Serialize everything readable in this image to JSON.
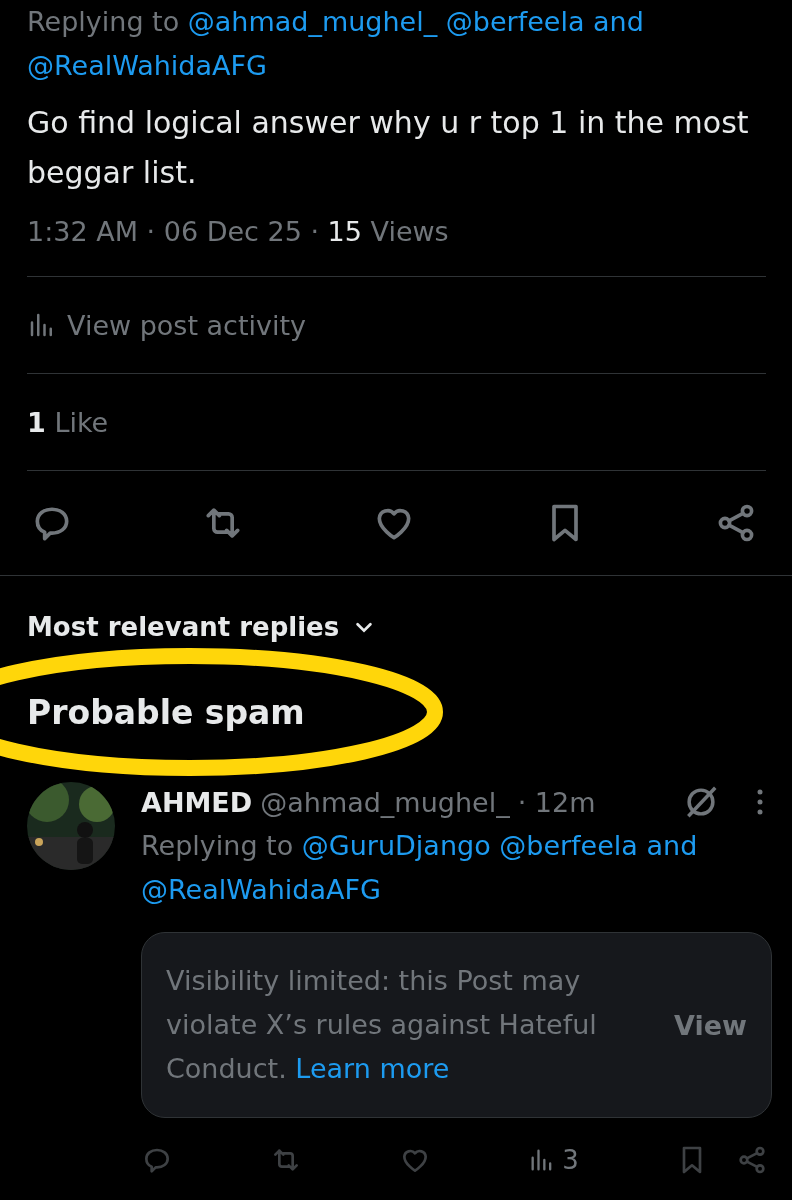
{
  "post": {
    "replying_to": [
      {
        "kind": "plain",
        "text": "Replying to"
      },
      {
        "kind": "mention",
        "text": "@ahmad_mughel_"
      },
      {
        "kind": "mention",
        "text": "@berfeela"
      },
      {
        "kind": "mention",
        "text": "and"
      },
      {
        "kind": "mention",
        "text": "@RealWahidaAFG"
      }
    ],
    "text": "Go find logical answer why u r top 1 in the most beggar list.",
    "meta": "1:32 AM · 06 Dec 25 · **15** Views",
    "activity": "View post activity",
    "likes": "**1** Like"
  },
  "replies_sort": {
    "label": "Most relevant replies",
    "expanded": false
  },
  "section_title": "Probable spam",
  "reply": {
    "name": "AHMED",
    "handle": "@ahmad_mughel_",
    "time": "· 12m",
    "replying_to": [
      {
        "kind": "plain",
        "text": "Replying to"
      },
      {
        "kind": "mention",
        "text": "@GuruDjango"
      },
      {
        "kind": "mention",
        "text": "@berfeela"
      },
      {
        "kind": "mention",
        "text": "and"
      },
      {
        "kind": "mention",
        "text": "@RealWahidaAFG"
      }
    ],
    "notice": {
      "text": "Visibility limited: this Post may violate X’s rules against Hateful Conduct.",
      "link": "Learn more",
      "action": "View"
    },
    "views": "3"
  }
}
